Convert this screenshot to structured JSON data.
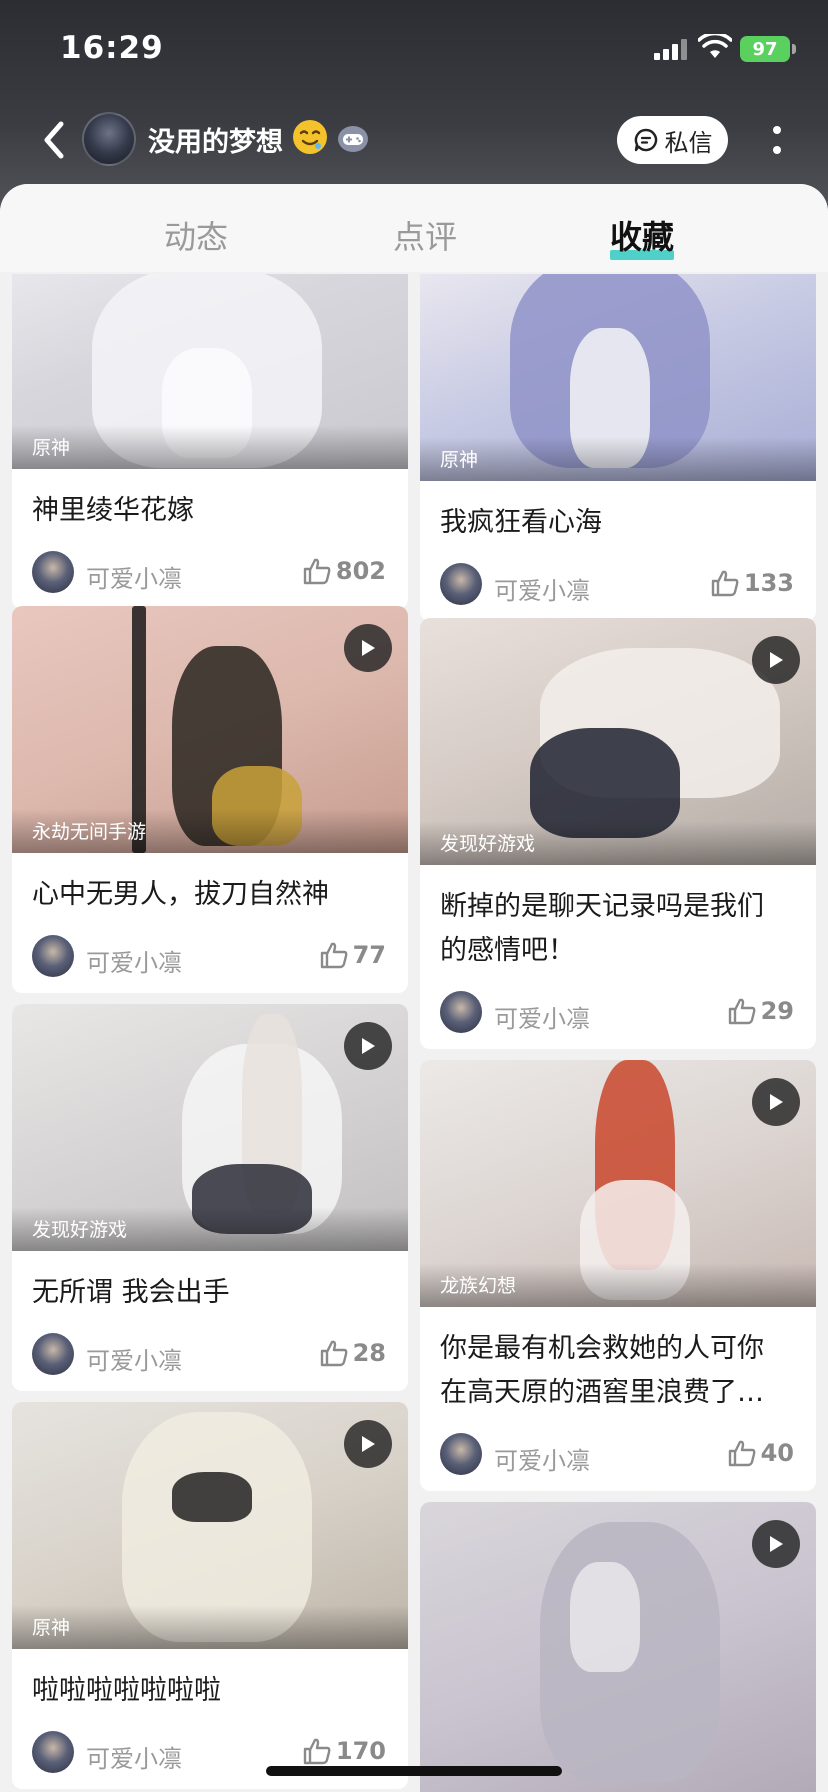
{
  "status_bar": {
    "time": "16:29",
    "battery": "97"
  },
  "header": {
    "username": "没用的梦想",
    "message_button": "私信"
  },
  "tabs": [
    {
      "label": "动态",
      "active": false
    },
    {
      "label": "点评",
      "active": false
    },
    {
      "label": "收藏",
      "active": true
    }
  ],
  "colors": {
    "tab_accent": "#4fd0c8",
    "battery": "#5ad05f"
  },
  "feed": {
    "left": [
      {
        "tag": "原神",
        "title": "神里绫华花嫁",
        "author": "可爱小凛",
        "likes": "802",
        "video": false
      },
      {
        "tag": "永劫无间手游",
        "title": "心中无男人，拔刀自然神",
        "author": "可爱小凛",
        "likes": "77",
        "video": true
      },
      {
        "tag": "发现好游戏",
        "title": "无所谓 我会出手",
        "author": "可爱小凛",
        "likes": "28",
        "video": true
      },
      {
        "tag": "原神",
        "title": "啦啦啦啦啦啦啦",
        "author": "可爱小凛",
        "likes": "170",
        "video": true
      }
    ],
    "right": [
      {
        "tag": "原神",
        "title": "我疯狂看心海",
        "author": "可爱小凛",
        "likes": "133",
        "video": false
      },
      {
        "tag": "发现好游戏",
        "title_line1": "断掉的是聊天记录吗是我们",
        "title_line2": "的感情吧！",
        "author": "可爱小凛",
        "likes": "29",
        "video": true
      },
      {
        "tag": "龙族幻想",
        "title_line1": "你是最有机会救她的人可你",
        "title_line2": "在高天原的酒窖里浪费了…",
        "author": "可爱小凛",
        "likes": "40",
        "video": true
      },
      {
        "video": true
      }
    ]
  }
}
